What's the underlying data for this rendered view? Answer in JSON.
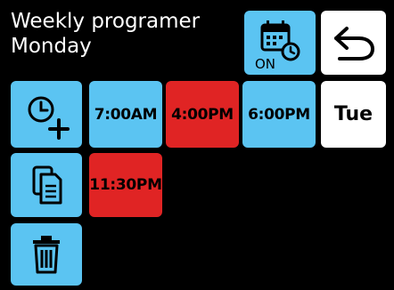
{
  "header": {
    "title_line1": "Weekly programer",
    "title_line2": "Monday"
  },
  "toolbar": {
    "schedule_on_label": "ON",
    "next_day_label": "Tue"
  },
  "time_slots": [
    {
      "label": "7:00AM",
      "color": "#5bc4f2"
    },
    {
      "label": "4:00PM",
      "color": "#e02424"
    },
    {
      "label": "6:00PM",
      "color": "#5bc4f2"
    },
    {
      "label": "11:30PM",
      "color": "#e02424"
    }
  ],
  "icons": {
    "calendar": "calendar-clock-icon",
    "back": "back-arrow-icon",
    "add": "add-time-icon",
    "copy": "copy-icon",
    "delete": "trash-icon"
  },
  "colors": {
    "accent_blue": "#5bc4f2",
    "accent_red": "#e02424",
    "background": "#000000"
  }
}
